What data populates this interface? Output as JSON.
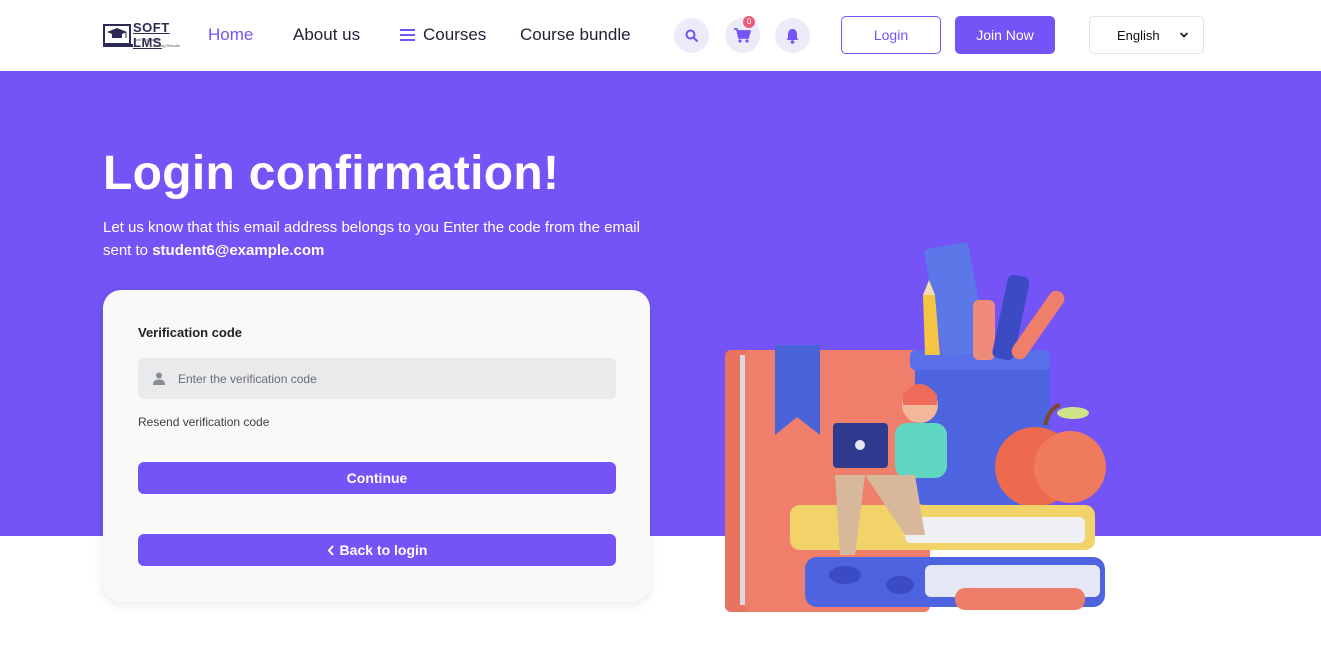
{
  "header": {
    "logo": {
      "title": "SOFT LMS",
      "tagline": "self-appraised",
      "tagline2": "Driving Results"
    },
    "nav": {
      "home": "Home",
      "about": "About us",
      "courses": "Courses",
      "bundle": "Course bundle"
    },
    "cart_count": "0",
    "login_label": "Login",
    "join_label": "Join Now",
    "language": "English"
  },
  "hero": {
    "title": "Login confirmation!",
    "description": "Let us know that this email address belongs to you Enter the code from the email sent to",
    "email": "student6@example.com"
  },
  "form": {
    "code_label": "Verification code",
    "code_placeholder": "Enter the verification code",
    "code_value": "",
    "resend_label": "Resend verification code",
    "continue_label": "Continue",
    "back_label": "Back to login"
  },
  "colors": {
    "primary": "#7454f6",
    "badge": "#ee5a7a",
    "card_bg": "#f9f9fa"
  }
}
